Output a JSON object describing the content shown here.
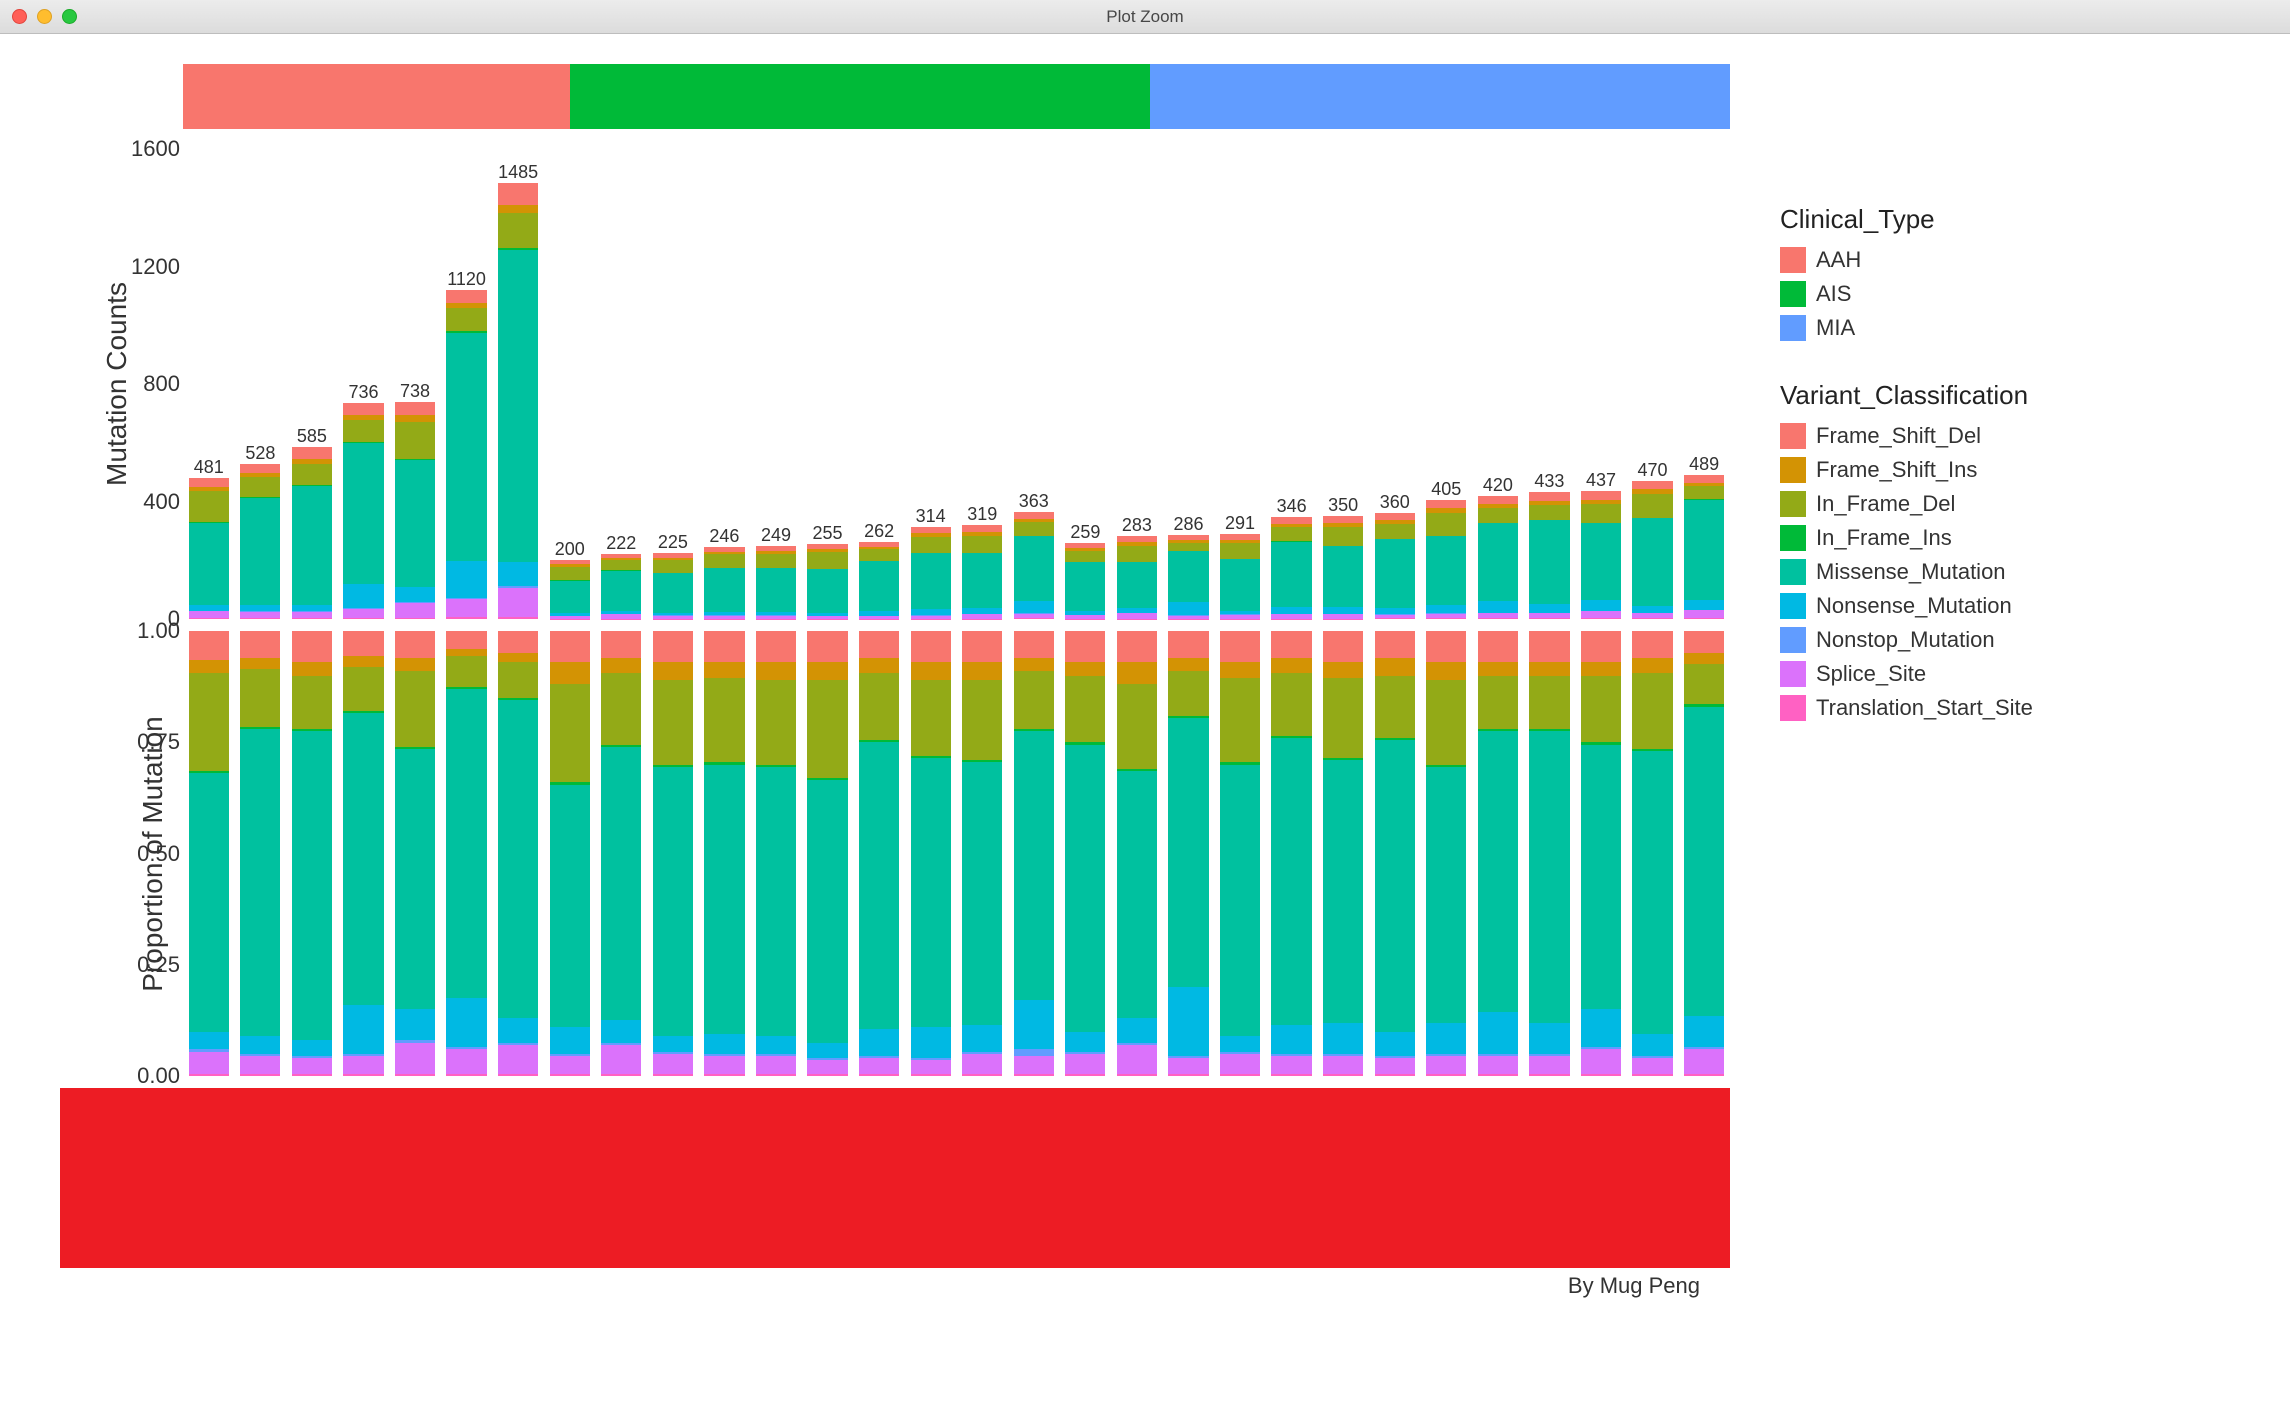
{
  "window": {
    "title": "Plot Zoom"
  },
  "credit": "By Mug Peng",
  "legends": {
    "clinical_title": "Clinical_Type",
    "clinical": [
      {
        "label": "AAH",
        "color": "#f8766d"
      },
      {
        "label": "AIS",
        "color": "#00ba38"
      },
      {
        "label": "MIA",
        "color": "#619cff"
      }
    ],
    "variant_title": "Variant_Classification",
    "variant": [
      {
        "label": "Frame_Shift_Del",
        "color": "#f8766e"
      },
      {
        "label": "Frame_Shift_Ins",
        "color": "#d39304"
      },
      {
        "label": "In_Frame_Del",
        "color": "#93aa17"
      },
      {
        "label": "In_Frame_Ins",
        "color": "#00ba38"
      },
      {
        "label": "Missense_Mutation",
        "color": "#00c19f"
      },
      {
        "label": "Nonsense_Mutation",
        "color": "#00b9e3"
      },
      {
        "label": "Nonstop_Mutation",
        "color": "#619cff"
      },
      {
        "label": "Splice_Site",
        "color": "#db72fb"
      },
      {
        "label": "Translation_Start_Site",
        "color": "#ff61c3"
      }
    ]
  },
  "chart_data": {
    "type": "bar",
    "panels": [
      "Mutation Counts",
      "Proportion of Mutation"
    ],
    "counts_axis": {
      "label": "Mutation Counts",
      "ticks": [
        0,
        400,
        800,
        1200,
        1600
      ],
      "ylim": [
        0,
        1600
      ]
    },
    "prop_axis": {
      "label": "Proportion of Mutation",
      "ticks": [
        0.0,
        0.25,
        0.5,
        0.75,
        1.0
      ],
      "ylim": [
        0,
        1
      ]
    },
    "clinical_strip": {
      "AAH": 8,
      "AIS": 12,
      "MIA": 12
    },
    "variant_colors": {
      "Frame_Shift_Del": "#f8766e",
      "Frame_Shift_Ins": "#d39304",
      "In_Frame_Del": "#93aa17",
      "In_Frame_Ins": "#00ba38",
      "Missense_Mutation": "#00c19f",
      "Nonsense_Mutation": "#00b9e3",
      "Nonstop_Mutation": "#619cff",
      "Splice_Site": "#db72fb",
      "Translation_Start_Site": "#ff61c3"
    },
    "samples": [
      {
        "clinical": "AAH",
        "total": 481,
        "label_dy": 0
      },
      {
        "clinical": "AAH",
        "total": 528,
        "label_dy": 0
      },
      {
        "clinical": "AAH",
        "total": 585,
        "label_dy": 0
      },
      {
        "clinical": "AAH",
        "total": 736,
        "label_dy": 0
      },
      {
        "clinical": "AAH",
        "total": 738,
        "label_dy": 0
      },
      {
        "clinical": "AAH",
        "total": 1120,
        "label_dy": 0
      },
      {
        "clinical": "AAH",
        "total": 1485,
        "label_dy": 0
      },
      {
        "clinical": "AAH",
        "total": 200,
        "label_dy": 0
      },
      {
        "clinical": "AIS",
        "total": 222,
        "label_dy": 0
      },
      {
        "clinical": "AIS",
        "total": 225,
        "label_dy": 0
      },
      {
        "clinical": "AIS",
        "total": 246,
        "label_dy": 0
      },
      {
        "clinical": "AIS",
        "total": 249,
        "label_dy": 0
      },
      {
        "clinical": "AIS",
        "total": 255,
        "label_dy": 0
      },
      {
        "clinical": "AIS",
        "total": 262,
        "label_dy": 0
      },
      {
        "clinical": "AIS",
        "total": 314,
        "label_dy": 0
      },
      {
        "clinical": "AIS",
        "total": 319,
        "label_dy": 0
      },
      {
        "clinical": "AIS",
        "total": 363,
        "label_dy": 0
      },
      {
        "clinical": "AIS",
        "total": 259,
        "label_dy": 0
      },
      {
        "clinical": "AIS",
        "total": 283,
        "label_dy": 0
      },
      {
        "clinical": "AIS",
        "total": 286,
        "label_dy": 0
      },
      {
        "clinical": "MIA",
        "total": 291,
        "label_dy": 0
      },
      {
        "clinical": "MIA",
        "total": 346,
        "label_dy": 0
      },
      {
        "clinical": "MIA",
        "total": 350,
        "label_dy": 0
      },
      {
        "clinical": "MIA",
        "total": 360,
        "label_dy": 0
      },
      {
        "clinical": "MIA",
        "total": 405,
        "label_dy": 0
      },
      {
        "clinical": "MIA",
        "total": 420,
        "label_dy": 0
      },
      {
        "clinical": "MIA",
        "total": 433,
        "label_dy": 0
      },
      {
        "clinical": "MIA",
        "total": 437,
        "label_dy": 0
      },
      {
        "clinical": "MIA",
        "total": 470,
        "label_dy": 0
      },
      {
        "clinical": "MIA",
        "total": 489,
        "label_dy": 0
      }
    ],
    "proportions": [
      {
        "Translation_Start_Site": 0.005,
        "Splice_Site": 0.05,
        "Nonstop_Mutation": 0.005,
        "Nonsense_Mutation": 0.04,
        "Missense_Mutation": 0.58,
        "In_Frame_Ins": 0.005,
        "In_Frame_Del": 0.22,
        "Frame_Shift_Ins": 0.03,
        "Frame_Shift_Del": 0.065
      },
      {
        "Translation_Start_Site": 0.005,
        "Splice_Site": 0.04,
        "Nonstop_Mutation": 0.005,
        "Nonsense_Mutation": 0.04,
        "Missense_Mutation": 0.69,
        "In_Frame_Ins": 0.005,
        "In_Frame_Del": 0.13,
        "Frame_Shift_Ins": 0.025,
        "Frame_Shift_Del": 0.06
      },
      {
        "Translation_Start_Site": 0.005,
        "Splice_Site": 0.035,
        "Nonstop_Mutation": 0.005,
        "Nonsense_Mutation": 0.035,
        "Missense_Mutation": 0.695,
        "In_Frame_Ins": 0.005,
        "In_Frame_Del": 0.12,
        "Frame_Shift_Ins": 0.03,
        "Frame_Shift_Del": 0.07
      },
      {
        "Translation_Start_Site": 0.005,
        "Splice_Site": 0.04,
        "Nonstop_Mutation": 0.005,
        "Nonsense_Mutation": 0.11,
        "Missense_Mutation": 0.655,
        "In_Frame_Ins": 0.005,
        "In_Frame_Del": 0.1,
        "Frame_Shift_Ins": 0.025,
        "Frame_Shift_Del": 0.055
      },
      {
        "Translation_Start_Site": 0.005,
        "Splice_Site": 0.07,
        "Nonstop_Mutation": 0.005,
        "Nonsense_Mutation": 0.07,
        "Missense_Mutation": 0.585,
        "In_Frame_Ins": 0.005,
        "In_Frame_Del": 0.17,
        "Frame_Shift_Ins": 0.03,
        "Frame_Shift_Del": 0.06
      },
      {
        "Translation_Start_Site": 0.005,
        "Splice_Site": 0.055,
        "Nonstop_Mutation": 0.005,
        "Nonsense_Mutation": 0.11,
        "Missense_Mutation": 0.695,
        "In_Frame_Ins": 0.005,
        "In_Frame_Del": 0.07,
        "Frame_Shift_Ins": 0.015,
        "Frame_Shift_Del": 0.04
      },
      {
        "Translation_Start_Site": 0.005,
        "Splice_Site": 0.065,
        "Nonstop_Mutation": 0.005,
        "Nonsense_Mutation": 0.055,
        "Missense_Mutation": 0.715,
        "In_Frame_Ins": 0.005,
        "In_Frame_Del": 0.08,
        "Frame_Shift_Ins": 0.02,
        "Frame_Shift_Del": 0.05
      },
      {
        "Translation_Start_Site": 0.005,
        "Splice_Site": 0.04,
        "Nonstop_Mutation": 0.005,
        "Nonsense_Mutation": 0.06,
        "Missense_Mutation": 0.545,
        "In_Frame_Ins": 0.005,
        "In_Frame_Del": 0.22,
        "Frame_Shift_Ins": 0.05,
        "Frame_Shift_Del": 0.07
      },
      {
        "Translation_Start_Site": 0.005,
        "Splice_Site": 0.065,
        "Nonstop_Mutation": 0.005,
        "Nonsense_Mutation": 0.05,
        "Missense_Mutation": 0.615,
        "In_Frame_Ins": 0.005,
        "In_Frame_Del": 0.16,
        "Frame_Shift_Ins": 0.035,
        "Frame_Shift_Del": 0.06
      },
      {
        "Translation_Start_Site": 0.005,
        "Splice_Site": 0.045,
        "Nonstop_Mutation": 0.005,
        "Nonsense_Mutation": 0.035,
        "Missense_Mutation": 0.605,
        "In_Frame_Ins": 0.005,
        "In_Frame_Del": 0.19,
        "Frame_Shift_Ins": 0.04,
        "Frame_Shift_Del": 0.07
      },
      {
        "Translation_Start_Site": 0.005,
        "Splice_Site": 0.04,
        "Nonstop_Mutation": 0.005,
        "Nonsense_Mutation": 0.045,
        "Missense_Mutation": 0.605,
        "In_Frame_Ins": 0.005,
        "In_Frame_Del": 0.19,
        "Frame_Shift_Ins": 0.035,
        "Frame_Shift_Del": 0.07
      },
      {
        "Translation_Start_Site": 0.005,
        "Splice_Site": 0.04,
        "Nonstop_Mutation": 0.005,
        "Nonsense_Mutation": 0.04,
        "Missense_Mutation": 0.605,
        "In_Frame_Ins": 0.005,
        "In_Frame_Del": 0.19,
        "Frame_Shift_Ins": 0.04,
        "Frame_Shift_Del": 0.07
      },
      {
        "Translation_Start_Site": 0.005,
        "Splice_Site": 0.03,
        "Nonstop_Mutation": 0.005,
        "Nonsense_Mutation": 0.035,
        "Missense_Mutation": 0.59,
        "In_Frame_Ins": 0.005,
        "In_Frame_Del": 0.22,
        "Frame_Shift_Ins": 0.04,
        "Frame_Shift_Del": 0.07
      },
      {
        "Translation_Start_Site": 0.005,
        "Splice_Site": 0.035,
        "Nonstop_Mutation": 0.005,
        "Nonsense_Mutation": 0.06,
        "Missense_Mutation": 0.645,
        "In_Frame_Ins": 0.005,
        "In_Frame_Del": 0.15,
        "Frame_Shift_Ins": 0.035,
        "Frame_Shift_Del": 0.06
      },
      {
        "Translation_Start_Site": 0.005,
        "Splice_Site": 0.03,
        "Nonstop_Mutation": 0.005,
        "Nonsense_Mutation": 0.07,
        "Missense_Mutation": 0.605,
        "In_Frame_Ins": 0.005,
        "In_Frame_Del": 0.17,
        "Frame_Shift_Ins": 0.04,
        "Frame_Shift_Del": 0.07
      },
      {
        "Translation_Start_Site": 0.005,
        "Splice_Site": 0.045,
        "Nonstop_Mutation": 0.005,
        "Nonsense_Mutation": 0.06,
        "Missense_Mutation": 0.59,
        "In_Frame_Ins": 0.005,
        "In_Frame_Del": 0.18,
        "Frame_Shift_Ins": 0.04,
        "Frame_Shift_Del": 0.07
      },
      {
        "Translation_Start_Site": 0.005,
        "Splice_Site": 0.04,
        "Nonstop_Mutation": 0.015,
        "Nonsense_Mutation": 0.11,
        "Missense_Mutation": 0.605,
        "In_Frame_Ins": 0.005,
        "In_Frame_Del": 0.13,
        "Frame_Shift_Ins": 0.03,
        "Frame_Shift_Del": 0.06
      },
      {
        "Translation_Start_Site": 0.005,
        "Splice_Site": 0.045,
        "Nonstop_Mutation": 0.005,
        "Nonsense_Mutation": 0.045,
        "Missense_Mutation": 0.645,
        "In_Frame_Ins": 0.005,
        "In_Frame_Del": 0.15,
        "Frame_Shift_Ins": 0.03,
        "Frame_Shift_Del": 0.07
      },
      {
        "Translation_Start_Site": 0.005,
        "Splice_Site": 0.065,
        "Nonstop_Mutation": 0.005,
        "Nonsense_Mutation": 0.055,
        "Missense_Mutation": 0.555,
        "In_Frame_Ins": 0.005,
        "In_Frame_Del": 0.19,
        "Frame_Shift_Ins": 0.05,
        "Frame_Shift_Del": 0.07
      },
      {
        "Translation_Start_Site": 0.005,
        "Splice_Site": 0.035,
        "Nonstop_Mutation": 0.005,
        "Nonsense_Mutation": 0.155,
        "Missense_Mutation": 0.605,
        "In_Frame_Ins": 0.005,
        "In_Frame_Del": 0.1,
        "Frame_Shift_Ins": 0.03,
        "Frame_Shift_Del": 0.06
      },
      {
        "Translation_Start_Site": 0.005,
        "Splice_Site": 0.045,
        "Nonstop_Mutation": 0.005,
        "Nonsense_Mutation": 0.035,
        "Missense_Mutation": 0.61,
        "In_Frame_Ins": 0.005,
        "In_Frame_Del": 0.19,
        "Frame_Shift_Ins": 0.035,
        "Frame_Shift_Del": 0.07
      },
      {
        "Translation_Start_Site": 0.005,
        "Splice_Site": 0.04,
        "Nonstop_Mutation": 0.005,
        "Nonsense_Mutation": 0.065,
        "Missense_Mutation": 0.645,
        "In_Frame_Ins": 0.005,
        "In_Frame_Del": 0.14,
        "Frame_Shift_Ins": 0.035,
        "Frame_Shift_Del": 0.06
      },
      {
        "Translation_Start_Site": 0.005,
        "Splice_Site": 0.04,
        "Nonstop_Mutation": 0.005,
        "Nonsense_Mutation": 0.07,
        "Missense_Mutation": 0.59,
        "In_Frame_Ins": 0.005,
        "In_Frame_Del": 0.18,
        "Frame_Shift_Ins": 0.035,
        "Frame_Shift_Del": 0.07
      },
      {
        "Translation_Start_Site": 0.005,
        "Splice_Site": 0.035,
        "Nonstop_Mutation": 0.005,
        "Nonsense_Mutation": 0.055,
        "Missense_Mutation": 0.655,
        "In_Frame_Ins": 0.005,
        "In_Frame_Del": 0.14,
        "Frame_Shift_Ins": 0.04,
        "Frame_Shift_Del": 0.06
      },
      {
        "Translation_Start_Site": 0.005,
        "Splice_Site": 0.04,
        "Nonstop_Mutation": 0.005,
        "Nonsense_Mutation": 0.07,
        "Missense_Mutation": 0.575,
        "In_Frame_Ins": 0.005,
        "In_Frame_Del": 0.19,
        "Frame_Shift_Ins": 0.04,
        "Frame_Shift_Del": 0.07
      },
      {
        "Translation_Start_Site": 0.005,
        "Splice_Site": 0.04,
        "Nonstop_Mutation": 0.005,
        "Nonsense_Mutation": 0.095,
        "Missense_Mutation": 0.63,
        "In_Frame_Ins": 0.005,
        "In_Frame_Del": 0.12,
        "Frame_Shift_Ins": 0.03,
        "Frame_Shift_Del": 0.07
      },
      {
        "Translation_Start_Site": 0.005,
        "Splice_Site": 0.04,
        "Nonstop_Mutation": 0.005,
        "Nonsense_Mutation": 0.07,
        "Missense_Mutation": 0.655,
        "In_Frame_Ins": 0.005,
        "In_Frame_Del": 0.12,
        "Frame_Shift_Ins": 0.03,
        "Frame_Shift_Del": 0.07
      },
      {
        "Translation_Start_Site": 0.005,
        "Splice_Site": 0.055,
        "Nonstop_Mutation": 0.005,
        "Nonsense_Mutation": 0.085,
        "Missense_Mutation": 0.595,
        "In_Frame_Ins": 0.005,
        "In_Frame_Del": 0.15,
        "Frame_Shift_Ins": 0.03,
        "Frame_Shift_Del": 0.07
      },
      {
        "Translation_Start_Site": 0.005,
        "Splice_Site": 0.035,
        "Nonstop_Mutation": 0.005,
        "Nonsense_Mutation": 0.05,
        "Missense_Mutation": 0.635,
        "In_Frame_Ins": 0.005,
        "In_Frame_Del": 0.17,
        "Frame_Shift_Ins": 0.035,
        "Frame_Shift_Del": 0.06
      },
      {
        "Translation_Start_Site": 0.005,
        "Splice_Site": 0.055,
        "Nonstop_Mutation": 0.005,
        "Nonsense_Mutation": 0.07,
        "Missense_Mutation": 0.695,
        "In_Frame_Ins": 0.005,
        "In_Frame_Del": 0.09,
        "Frame_Shift_Ins": 0.025,
        "Frame_Shift_Del": 0.05
      }
    ]
  }
}
